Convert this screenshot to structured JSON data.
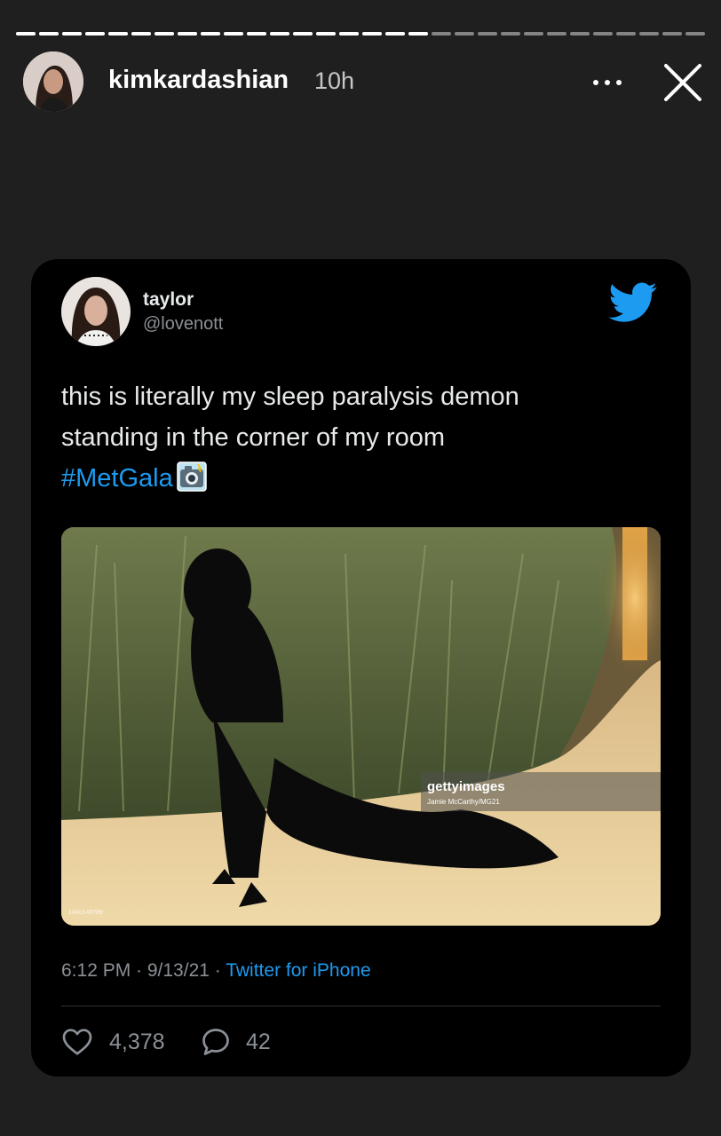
{
  "story": {
    "username": "kimkardashian",
    "time_ago": "10h",
    "progress": {
      "segments_total": 30,
      "segments_viewed": 18
    }
  },
  "tweet": {
    "display_name": "taylor",
    "handle": "@lovenott",
    "text_line1": "this is literally my sleep paralysis demon",
    "text_line2": "standing in the corner of my room",
    "hashtag": "#MetGala",
    "emoji_name": "camera-with-flash-emoji",
    "photo": {
      "watermark_brand": "gettyimages",
      "watermark_credit": "Jamie McCarthy/MG21",
      "image_id": "1340149789"
    },
    "timestamp": "6:12 PM · 9/13/21 · ",
    "source": "Twitter for iPhone",
    "likes": "4,378",
    "replies": "42"
  },
  "colors": {
    "accent_blue": "#1d9bf0",
    "story_bg": "#1f1f1f",
    "card_bg": "#000000"
  }
}
